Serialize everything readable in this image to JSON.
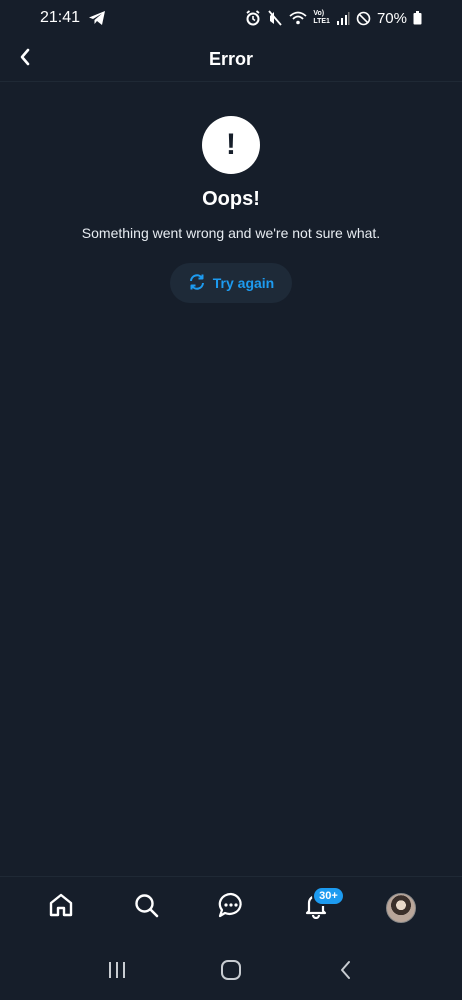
{
  "status_bar": {
    "time": "21:41",
    "battery": "70%",
    "network_label_top": "Vo)",
    "network_label_bottom": "LTE1"
  },
  "app_bar": {
    "title": "Error"
  },
  "error": {
    "heading": "Oops!",
    "message": "Something went wrong and we're not sure what.",
    "icon_glyph": "!",
    "retry_label": "Try again"
  },
  "bottom_nav": {
    "items": [
      "home",
      "search",
      "messages",
      "notifications",
      "profile"
    ],
    "notifications_badge": "30+"
  },
  "colors": {
    "background": "#161e2a",
    "accent": "#1d9bf0",
    "text": "#ffffff"
  }
}
